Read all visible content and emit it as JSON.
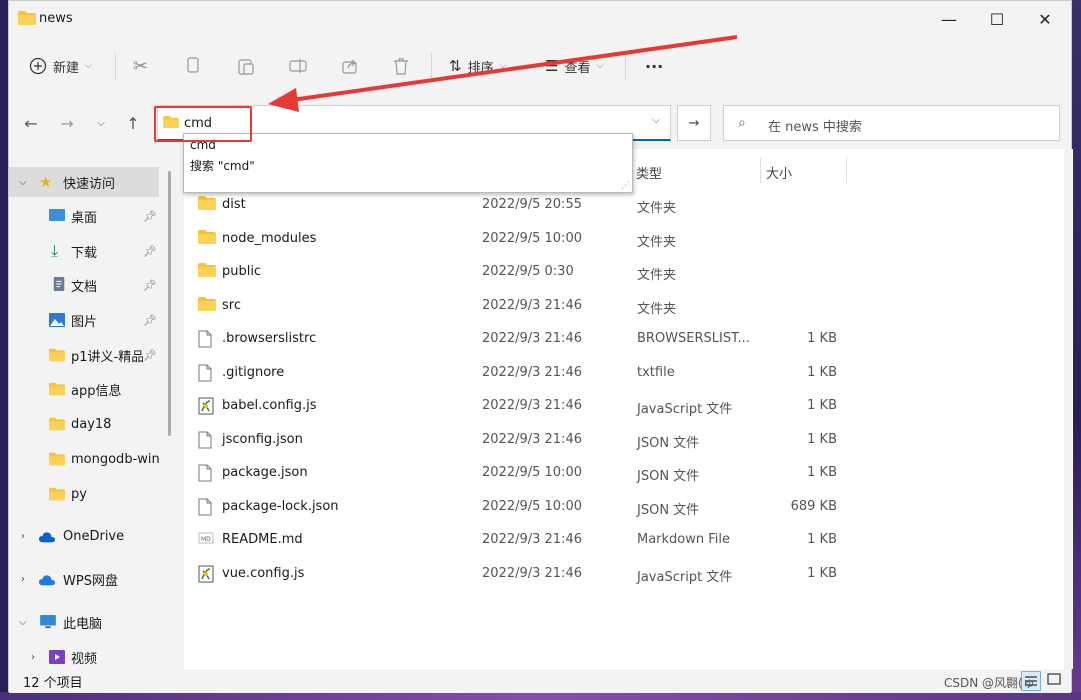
{
  "window": {
    "title": "news",
    "min": "—",
    "max": "☐",
    "close": "✕"
  },
  "toolbar": {
    "new_label": "新建",
    "sort_label": "排序",
    "view_label": "查看",
    "more": "···"
  },
  "address": {
    "value": "cmd",
    "dropdown": "⌵"
  },
  "search": {
    "placeholder": "在 news 中搜索"
  },
  "autocomplete": {
    "item1": "cmd",
    "item2": "搜索 \"cmd\""
  },
  "columns": {
    "type": "类型",
    "size": "大小"
  },
  "sidebar": {
    "quick_access": "快速访问",
    "items": [
      {
        "label": "桌面",
        "icon": "desktop-icon",
        "pinned": true
      },
      {
        "label": "下载",
        "icon": "download-icon",
        "pinned": true
      },
      {
        "label": "文档",
        "icon": "document-icon",
        "pinned": true
      },
      {
        "label": "图片",
        "icon": "picture-icon",
        "pinned": true
      },
      {
        "label": "p1讲义-精品",
        "icon": "folder-icon",
        "pinned": true
      },
      {
        "label": "app信息",
        "icon": "folder-icon",
        "pinned": false
      },
      {
        "label": "day18",
        "icon": "folder-icon",
        "pinned": false
      },
      {
        "label": "mongodb-win",
        "icon": "folder-icon",
        "pinned": false
      },
      {
        "label": "py",
        "icon": "folder-icon",
        "pinned": false
      }
    ],
    "onedrive": "OneDrive",
    "wps": "WPS网盘",
    "this_pc": "此电脑",
    "video": "视频"
  },
  "files": [
    {
      "name": "dist",
      "date": "2022/9/5 20:55",
      "type": "文件夹",
      "size": "",
      "icon": "folder"
    },
    {
      "name": "node_modules",
      "date": "2022/9/5 10:00",
      "type": "文件夹",
      "size": "",
      "icon": "folder"
    },
    {
      "name": "public",
      "date": "2022/9/5 0:30",
      "type": "文件夹",
      "size": "",
      "icon": "folder"
    },
    {
      "name": "src",
      "date": "2022/9/3 21:46",
      "type": "文件夹",
      "size": "",
      "icon": "folder"
    },
    {
      "name": ".browserslistrc",
      "date": "2022/9/3 21:46",
      "type": "BROWSERSLIST...",
      "size": "1 KB",
      "icon": "file"
    },
    {
      "name": ".gitignore",
      "date": "2022/9/3 21:46",
      "type": "txtfile",
      "size": "1 KB",
      "icon": "file"
    },
    {
      "name": "babel.config.js",
      "date": "2022/9/3 21:46",
      "type": "JavaScript 文件",
      "size": "1 KB",
      "icon": "js"
    },
    {
      "name": "jsconfig.json",
      "date": "2022/9/3 21:46",
      "type": "JSON 文件",
      "size": "1 KB",
      "icon": "file"
    },
    {
      "name": "package.json",
      "date": "2022/9/5 10:00",
      "type": "JSON 文件",
      "size": "1 KB",
      "icon": "file"
    },
    {
      "name": "package-lock.json",
      "date": "2022/9/5 10:00",
      "type": "JSON 文件",
      "size": "689 KB",
      "icon": "file"
    },
    {
      "name": "README.md",
      "date": "2022/9/3 21:46",
      "type": "Markdown File",
      "size": "1 KB",
      "icon": "md"
    },
    {
      "name": "vue.config.js",
      "date": "2022/9/3 21:46",
      "type": "JavaScript 文件",
      "size": "1 KB",
      "icon": "js"
    }
  ],
  "status": {
    "count": "12 个项目"
  },
  "watermark": "CSDN @风翾(ゅ",
  "colors": {
    "accent": "#0067c0",
    "folder": "#f8c33c",
    "highlight": "#e53935"
  }
}
